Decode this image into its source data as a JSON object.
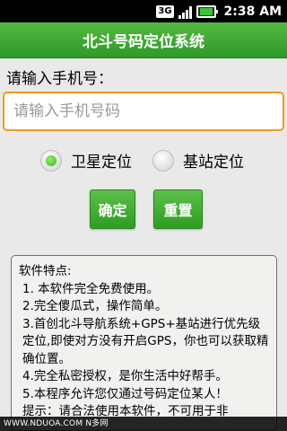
{
  "status_bar": {
    "network": "3G",
    "time": "2:38 AM"
  },
  "app_title": "北斗号码定位系统",
  "form": {
    "prompt": "请输入手机号：",
    "phone_value": "",
    "phone_placeholder": "请输入手机号码"
  },
  "radio_options": [
    {
      "label": "卫星定位",
      "selected": true
    },
    {
      "label": "基站定位",
      "selected": false
    }
  ],
  "buttons": {
    "confirm": "确定",
    "reset": "重置"
  },
  "info": {
    "heading": "软件特点:",
    "items": [
      "1. 本软件完全免费使用。",
      "2.完全傻瓜式，操作简单。",
      "3.首创北斗导航系统+GPS+基站进行优先级定位,即使对方没有开启GPS，你也可以获取精确位置。",
      "4.完全私密授权，是你生活中好帮手。",
      "5.本程序允许您仅通过号码定位某人！",
      "提示：请合法使用本软件，不可用于非"
    ]
  },
  "watermark": "WWW.NDUOA.COM N多网"
}
